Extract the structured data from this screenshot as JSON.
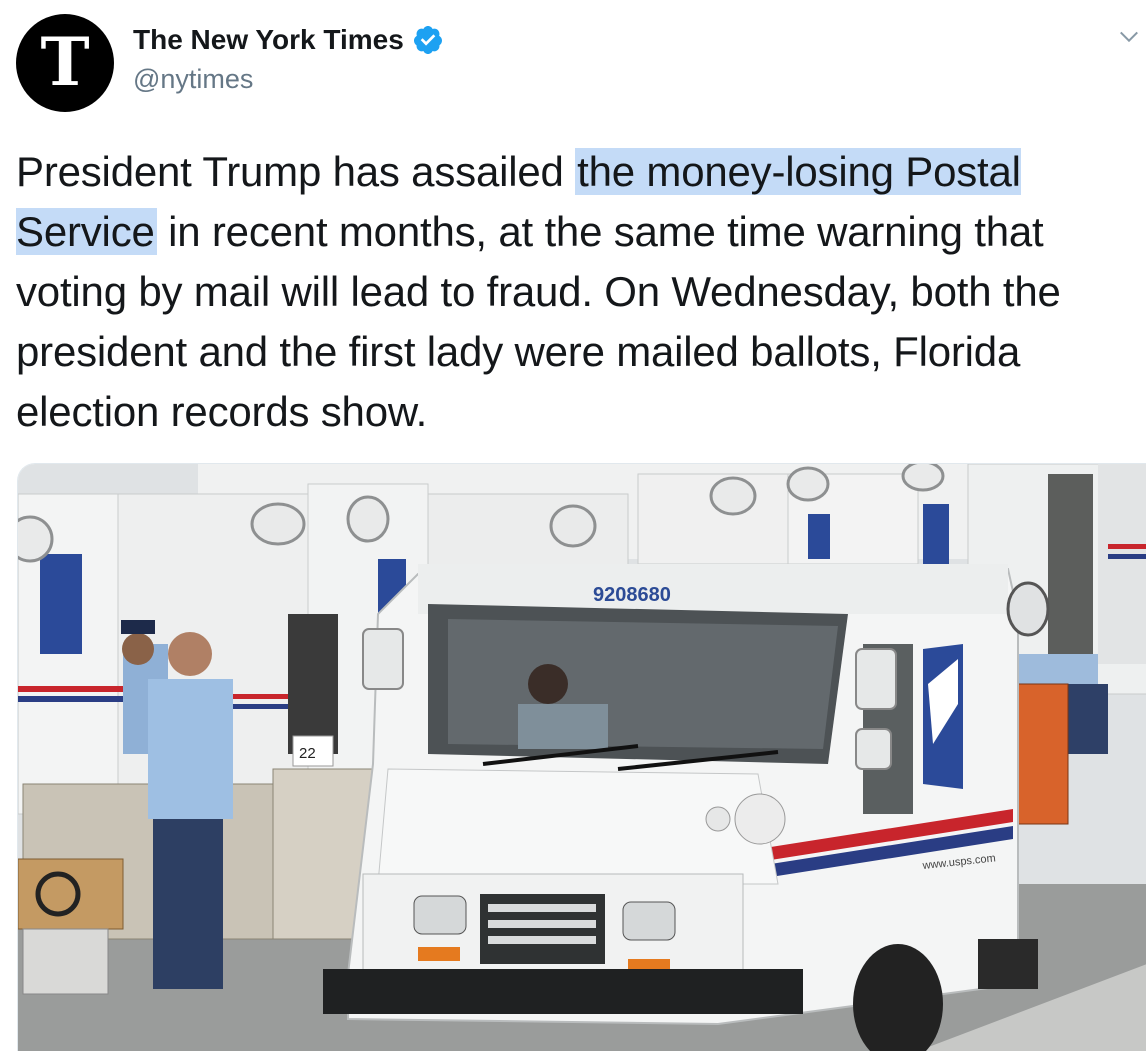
{
  "account": {
    "display_name": "The New York Times",
    "handle": "@nytimes",
    "avatar_letter": "T",
    "verified": true,
    "verified_color": "#1da1f2"
  },
  "tweet": {
    "text_before": "President Trump has assailed ",
    "text_link": "the money-losing Postal Service",
    "text_after": " in recent months, at the same time warning that voting by mail will lead to fraud. On Wednesday, both the president and the first lady were mailed ballots, Florida election records show.",
    "highlight_color": "#c4dbf7"
  },
  "media": {
    "truck_number": "9208680",
    "website_text": "www.usps.com",
    "cart_number": "22"
  },
  "icons": {
    "menu": "chevron-down-icon",
    "verified": "verified-badge-icon"
  }
}
